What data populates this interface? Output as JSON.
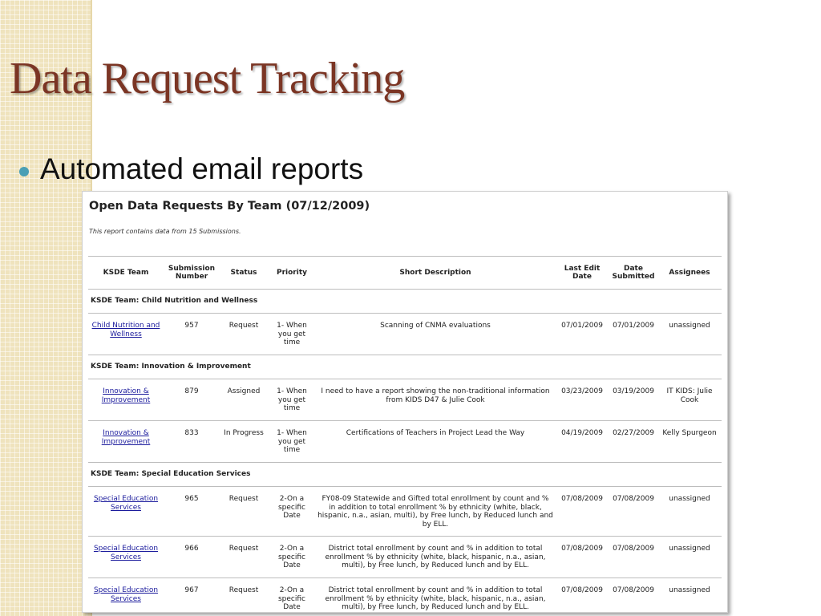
{
  "slide": {
    "title": "Data Request Tracking",
    "bullet": "Automated email reports"
  },
  "report": {
    "title": "Open Data Requests By Team (07/12/2009)",
    "note": "This report contains data from 15 Submissions.",
    "columns": [
      "KSDE Team",
      "Submission Number",
      "Status",
      "Priority",
      "Short Description",
      "Last Edit Date",
      "Date Submitted",
      "Assignees"
    ],
    "groups": [
      {
        "label": "KSDE Team: Child Nutrition and Wellness",
        "rows": [
          {
            "team": "Child Nutrition and Wellness",
            "number": "957",
            "status": "Request",
            "priority": "1- When you get time",
            "description": "Scanning of CNMA evaluations",
            "last_edit": "07/01/2009",
            "submitted": "07/01/2009",
            "assignees": "unassigned"
          }
        ]
      },
      {
        "label": "KSDE Team: Innovation & Improvement",
        "rows": [
          {
            "team": "Innovation & Improvement",
            "number": "879",
            "status": "Assigned",
            "priority": "1- When you get time",
            "description": "I need to have a report showing the non-traditional information from KIDS D47 & Julie Cook",
            "last_edit": "03/23/2009",
            "submitted": "03/19/2009",
            "assignees": "IT KIDS: Julie Cook"
          },
          {
            "team": "Innovation & Improvement",
            "number": "833",
            "status": "In Progress",
            "priority": "1- When you get time",
            "description": "Certifications of Teachers in Project Lead the Way",
            "last_edit": "04/19/2009",
            "submitted": "02/27/2009",
            "assignees": "Kelly Spurgeon"
          }
        ]
      },
      {
        "label": "KSDE Team: Special Education Services",
        "rows": [
          {
            "team": "Special Education Services",
            "number": "965",
            "status": "Request",
            "priority": "2-On a specific Date",
            "description": "FY08-09 Statewide and Gifted total enrollment by count and % in addition to total enrollment % by ethnicity (white, black, hispanic, n.a., asian, multi), by Free lunch, by Reduced lunch and by ELL.",
            "last_edit": "07/08/2009",
            "submitted": "07/08/2009",
            "assignees": "unassigned"
          },
          {
            "team": "Special Education Services",
            "number": "966",
            "status": "Request",
            "priority": "2-On a specific Date",
            "description": "District total enrollment by count and % in addition to total enrollment % by ethnicity (white, black, hispanic, n.a., asian, multi), by Free lunch, by Reduced lunch and by ELL.",
            "last_edit": "07/08/2009",
            "submitted": "07/08/2009",
            "assignees": "unassigned"
          },
          {
            "team": "Special Education Services",
            "number": "967",
            "status": "Request",
            "priority": "2-On a specific Date",
            "description": "District total enrollment by count and % in addition to total enrollment % by ethnicity (white, black, hispanic, n.a., asian, multi), by Free lunch, by Reduced lunch and by ELL.",
            "last_edit": "07/08/2009",
            "submitted": "07/08/2009",
            "assignees": "unassigned"
          }
        ]
      }
    ]
  },
  "colors": {
    "title": "#7b3524",
    "bullet": "#4a9fb5",
    "sidebar": "#efe3bd",
    "link": "#1a1a9c"
  }
}
